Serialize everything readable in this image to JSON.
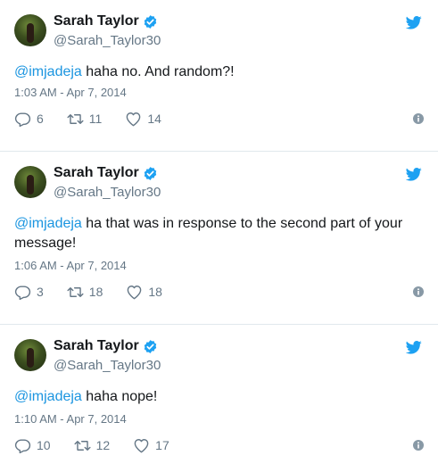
{
  "colors": {
    "mention": "#1b95e0",
    "verified": "#1da1f2",
    "twitter_bird": "#1da1f2",
    "secondary_text": "#657786",
    "divider": "#e1e8ed"
  },
  "tweets": [
    {
      "name": "Sarah Taylor",
      "handle": "@Sarah_Taylor30",
      "mention": "@imjadeja",
      "body": " haha no. And random?!",
      "time": "1:03 AM - Apr 7, 2014",
      "replies": "6",
      "retweets": "11",
      "likes": "14"
    },
    {
      "name": "Sarah Taylor",
      "handle": "@Sarah_Taylor30",
      "mention": "@imjadeja",
      "body": " ha that was in response to the second part of your message!",
      "time": "1:06 AM - Apr 7, 2014",
      "replies": "3",
      "retweets": "18",
      "likes": "18"
    },
    {
      "name": "Sarah Taylor",
      "handle": "@Sarah_Taylor30",
      "mention": "@imjadeja",
      "body": " haha nope!",
      "time": "1:10 AM - Apr 7, 2014",
      "replies": "10",
      "retweets": "12",
      "likes": "17"
    }
  ]
}
